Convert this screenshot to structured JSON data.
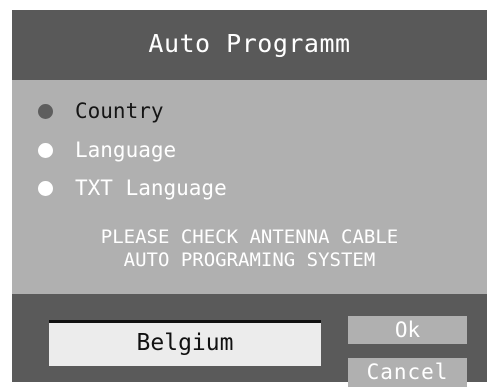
{
  "dialog": {
    "title": "Auto Programm",
    "options": [
      {
        "label": "Country",
        "selected": true
      },
      {
        "label": "Language",
        "selected": false
      },
      {
        "label": "TXT Language",
        "selected": false
      }
    ],
    "message": {
      "line1": "PLEASE CHECK ANTENNA CABLE",
      "line2": "AUTO PROGRAMING SYSTEM"
    },
    "country_value": "Belgium",
    "buttons": {
      "ok_label": "Ok",
      "cancel_label": "Cancel"
    }
  },
  "colors": {
    "panel_dark": "#5a5a5a",
    "panel_light": "#b0b0b0",
    "field_bg": "#ececec",
    "text_light": "#ffffff",
    "text_dark": "#111111"
  }
}
